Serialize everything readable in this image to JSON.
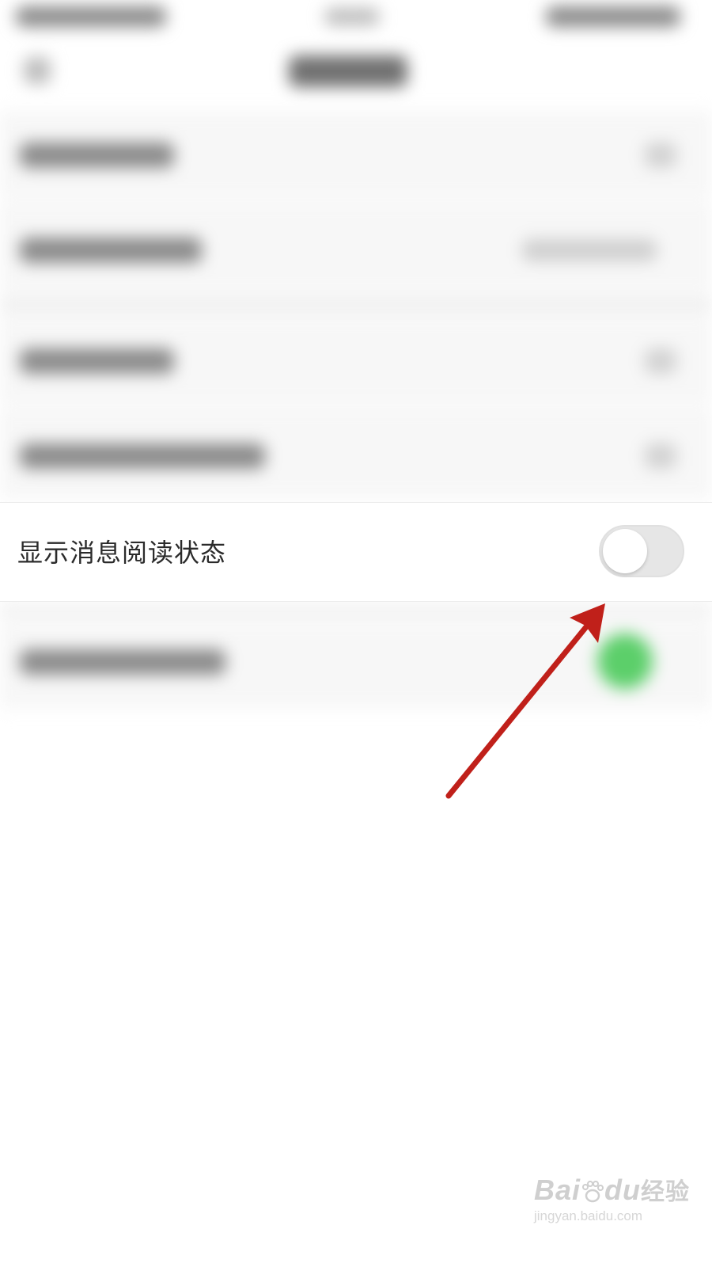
{
  "setting": {
    "label": "显示消息阅读状态",
    "toggle_on": false
  },
  "annotation": {
    "arrow_color": "#c0201a"
  },
  "watermark": {
    "brand": "Bai",
    "brand_suffix": "du",
    "product": "经验",
    "url": "jingyan.baidu.com"
  },
  "colors": {
    "toggle_off_track": "#e6e6e6",
    "toggle_knob": "#ffffff",
    "blurred_toggle_on": "#5ccf6a"
  }
}
